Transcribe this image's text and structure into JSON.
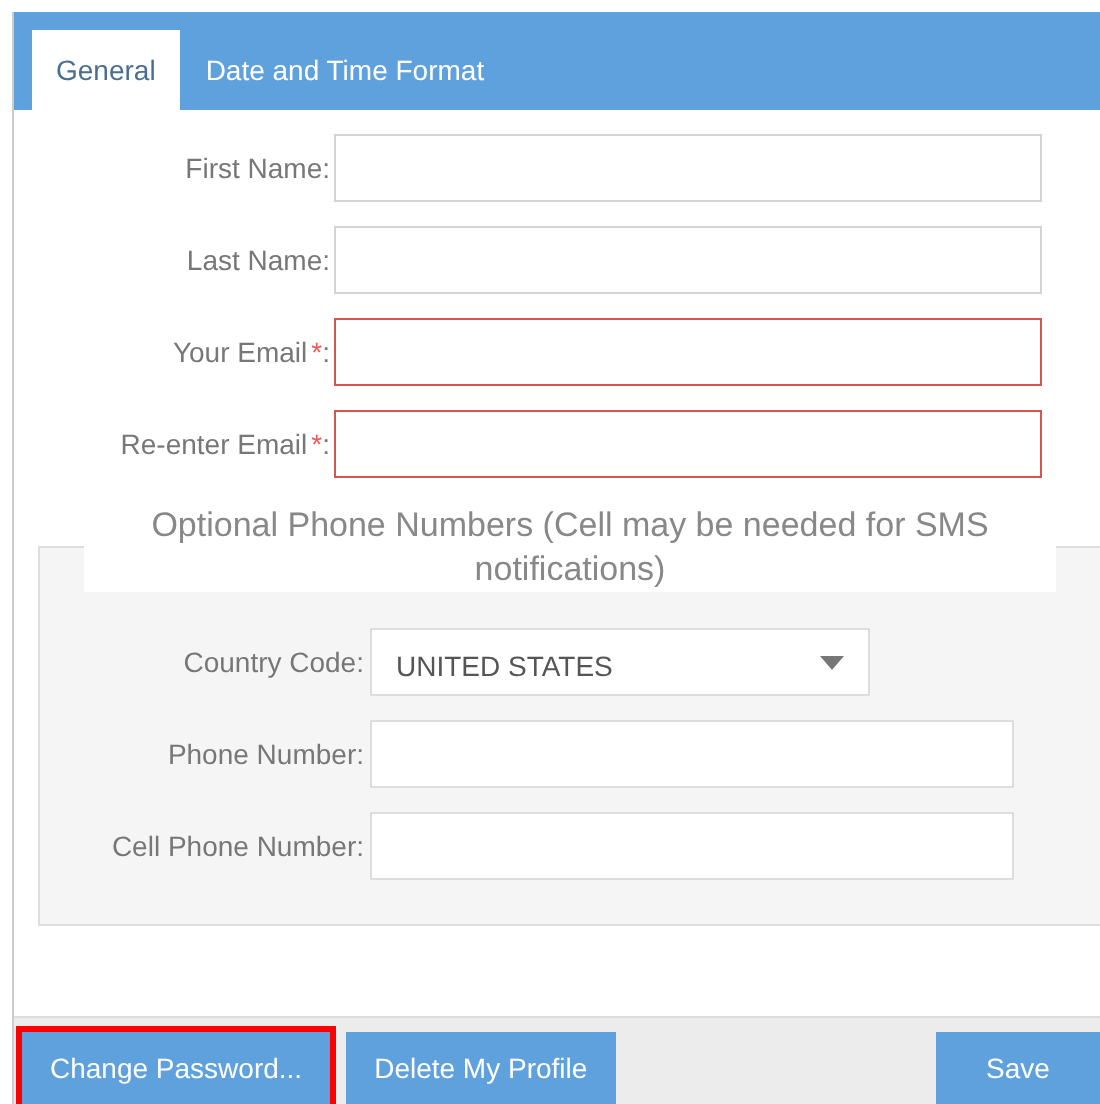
{
  "tabs": [
    {
      "label": "General",
      "selected": true
    },
    {
      "label": "Date and Time Format",
      "selected": false
    }
  ],
  "fields": [
    {
      "label": "First Name:",
      "required": false
    },
    {
      "label": "Last Name:",
      "required": false
    },
    {
      "label": "Your Email",
      "required": true,
      "required_mark": "*",
      "suffix": ":"
    },
    {
      "label": "Re-enter Email",
      "required": true,
      "required_mark": "*",
      "suffix": ":"
    }
  ],
  "phone_section": {
    "legend": "Optional Phone Numbers (Cell may be needed for SMS notifications)",
    "fields": [
      {
        "kind": "select",
        "label": "Country Code:",
        "value": "UNITED STATES"
      },
      {
        "kind": "text",
        "label": "Phone Number:"
      },
      {
        "kind": "text",
        "label": "Cell Phone Number:"
      }
    ]
  },
  "buttons": [
    {
      "label": "Change Password...",
      "highlighted": true
    },
    {
      "label": "Delete My Profile",
      "highlighted": false
    },
    {
      "label": "Save",
      "highlighted": false
    }
  ]
}
